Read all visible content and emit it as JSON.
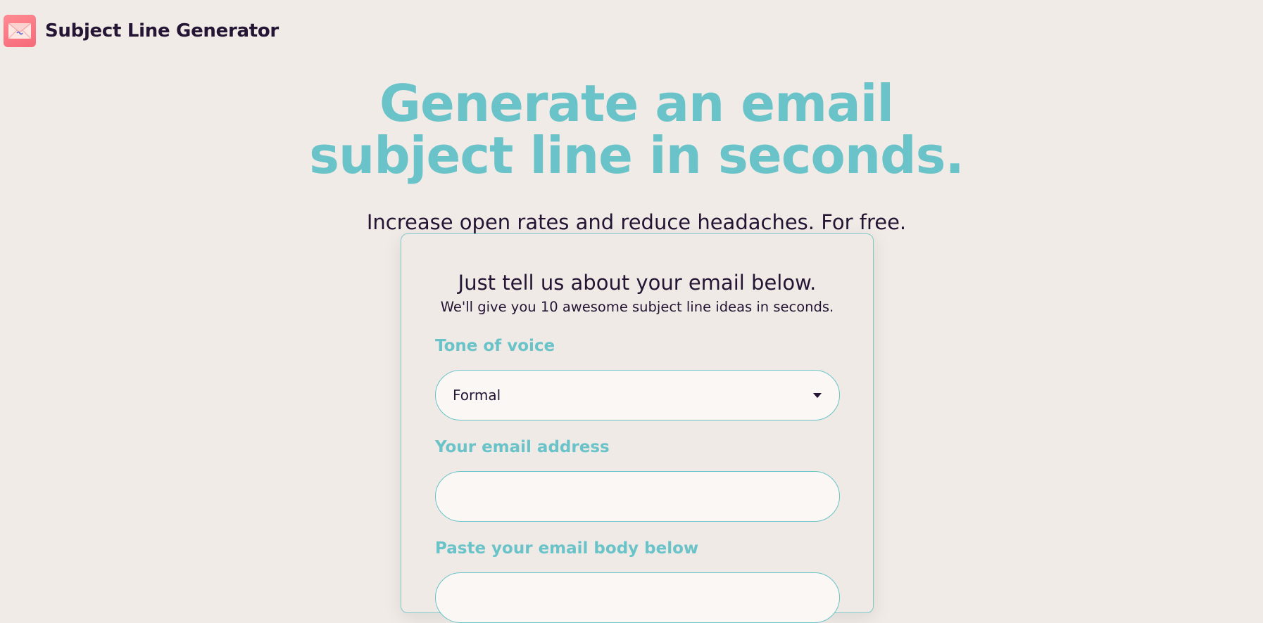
{
  "app": {
    "name": "Subject Line Generator",
    "logo_icon": "envelope-icon"
  },
  "hero": {
    "title_line1": "Generate an email",
    "title_line2": "subject line in seconds.",
    "subtitle": "Increase open rates and reduce headaches. For free."
  },
  "form": {
    "heading": "Just tell us about your email below.",
    "subheading": "We'll give you 10 awesome subject line ideas in seconds.",
    "tone": {
      "label": "Tone of voice",
      "value": "Formal"
    },
    "email": {
      "label": "Your email address",
      "value": "",
      "placeholder": ""
    },
    "body": {
      "label": "Paste your email body below",
      "value": "",
      "placeholder": ""
    }
  },
  "colors": {
    "accent": "#6ac3c8",
    "text": "#231533",
    "background": "#f0ebe7",
    "field_background": "#faf7f4",
    "logo": "#f66a78"
  }
}
